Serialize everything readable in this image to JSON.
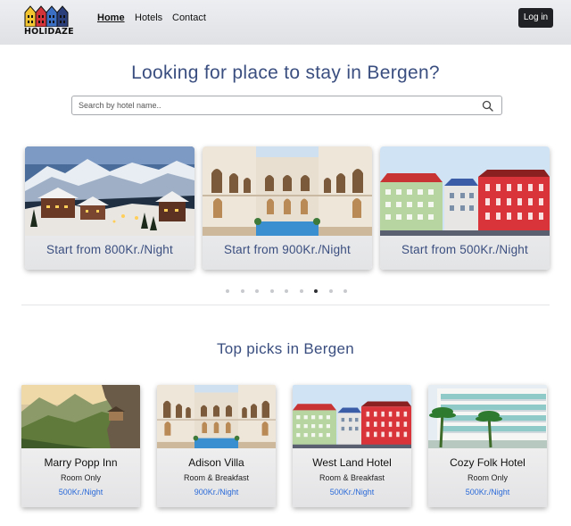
{
  "brand": {
    "name": "HOLIDAZE"
  },
  "nav": {
    "links": [
      {
        "label": "Home",
        "active": true
      },
      {
        "label": "Hotels",
        "active": false
      },
      {
        "label": "Contact",
        "active": false
      }
    ],
    "login_label": "Log in"
  },
  "hero": {
    "title": "Looking for place to stay in Bergen?",
    "search_placeholder": "Search by hotel name.."
  },
  "carousel": {
    "slides": [
      {
        "price": "Start from 800Kr./Night",
        "image": "snowy-mountain-village"
      },
      {
        "price": "Start from 900Kr./Night",
        "image": "hotel-courtyard-pool"
      },
      {
        "price": "Start from 500Kr./Night",
        "image": "colorful-hotel-facades"
      }
    ],
    "dot_count": 9,
    "active_dot": 6
  },
  "picks": {
    "title": "Top picks in Bergen",
    "cards": [
      {
        "name": "Marry Popp Inn",
        "board": "Room Only",
        "price": "500Kr./Night",
        "image": "cliff-mountain-lodge"
      },
      {
        "name": "Adison Villa",
        "board": "Room & Breakfast",
        "price": "900Kr./Night",
        "image": "hotel-courtyard-pool"
      },
      {
        "name": "West Land Hotel",
        "board": "Room & Breakfast",
        "price": "500Kr./Night",
        "image": "colorful-hotel-facades"
      },
      {
        "name": "Cozy Folk Hotel",
        "board": "Room Only",
        "price": "500Kr./Night",
        "image": "palm-hotel-balconies"
      }
    ]
  },
  "colors": {
    "accent": "#3a4e7f",
    "price_link": "#2a6ad8",
    "login_bg": "#1f2124"
  }
}
